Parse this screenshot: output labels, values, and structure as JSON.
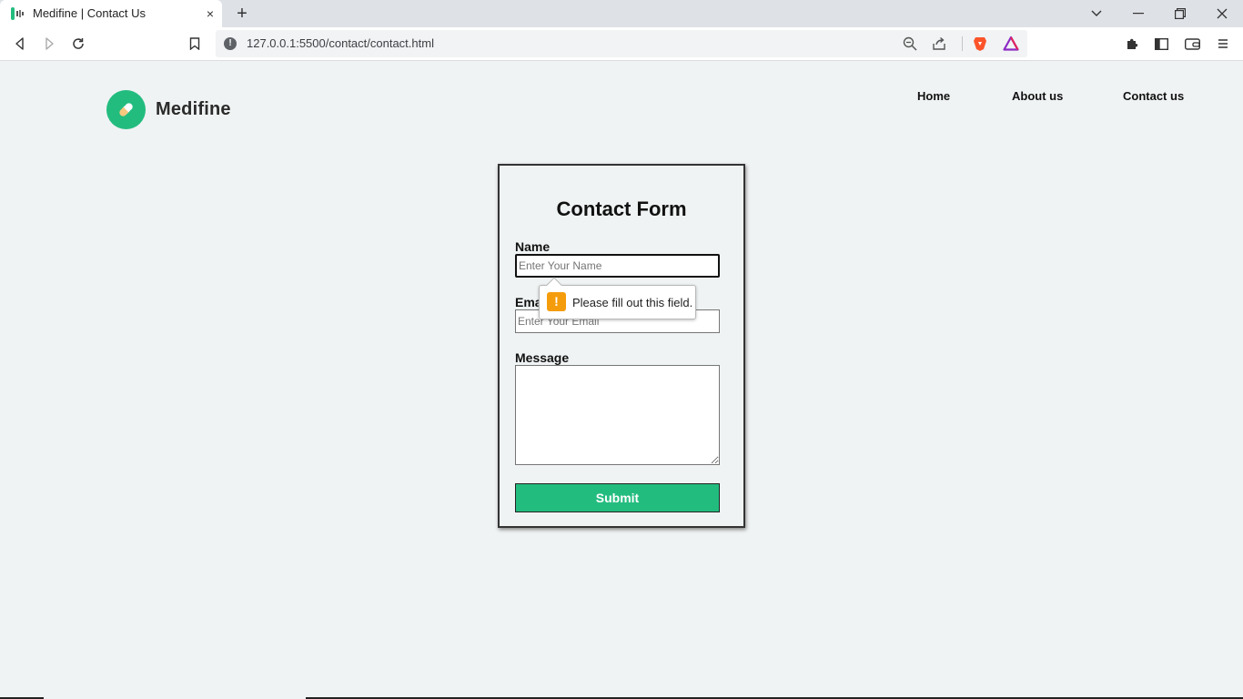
{
  "browser": {
    "tab_title": "Medifine | Contact Us",
    "close_tab": "×",
    "new_tab": "+",
    "url": "127.0.0.1:5500/contact/contact.html"
  },
  "site": {
    "brand": "Medifine",
    "brand_color": "#23bc7f",
    "nav": [
      "Home",
      "About us",
      "Contact us"
    ]
  },
  "form": {
    "title": "Contact Form",
    "name_label": "Name",
    "name_placeholder": "Enter Your Name",
    "email_label": "Email",
    "email_placeholder": "Enter Your Email",
    "message_label": "Message",
    "submit_label": "Submit",
    "validation_message": "Please fill out this field.",
    "validation_icon": "!"
  }
}
